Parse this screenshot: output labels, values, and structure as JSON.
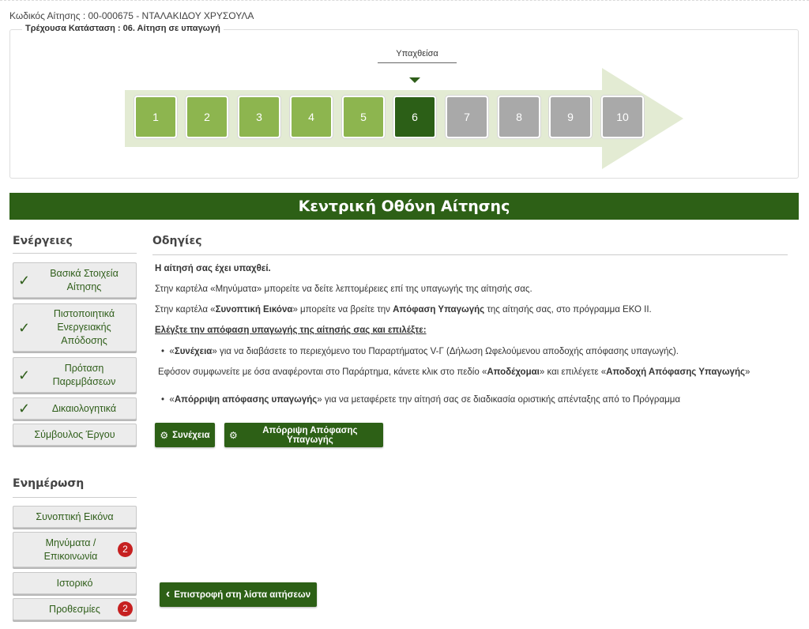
{
  "header": {
    "app_code": "Κωδικός Αίτησης : 00-000675 - ΝΤΑΛΑΚΙΔΟΥ ΧΡΥΣΟΥΛΑ",
    "current_status": "Τρέχουσα Κατάσταση : 06. Αίτηση σε υπαγωγή"
  },
  "progress": {
    "stage_label": "Υπαχθείσα",
    "current_step": 6,
    "steps": [
      {
        "label": "1",
        "state": "done"
      },
      {
        "label": "2",
        "state": "done"
      },
      {
        "label": "3",
        "state": "done"
      },
      {
        "label": "4",
        "state": "done"
      },
      {
        "label": "5",
        "state": "done"
      },
      {
        "label": "6",
        "state": "current"
      },
      {
        "label": "7",
        "state": "todo"
      },
      {
        "label": "8",
        "state": "todo"
      },
      {
        "label": "9",
        "state": "todo"
      },
      {
        "label": "10",
        "state": "todo"
      }
    ]
  },
  "main_title": "Κεντρική Οθόνη Αίτησης",
  "actions": {
    "title": "Ενέργειες",
    "items": [
      {
        "label": "Βασικά Στοιχεία Αίτησης",
        "checked": true
      },
      {
        "label": "Πιστοποιητικά Ενεργειακής Απόδοσης",
        "checked": true
      },
      {
        "label": "Πρόταση Παρεμβάσεων",
        "checked": true
      },
      {
        "label": "Δικαιολογητικά",
        "checked": true
      },
      {
        "label": "Σύμβουλος Έργου",
        "checked": false
      }
    ]
  },
  "info": {
    "title": "Ενημέρωση",
    "items": [
      {
        "label": "Συνοπτική Εικόνα",
        "badge": ""
      },
      {
        "label": "Μηνύματα / Επικοινωνία",
        "badge": "2"
      },
      {
        "label": "Ιστορικό",
        "badge": ""
      },
      {
        "label": "Προθεσμίες",
        "badge": "2"
      }
    ]
  },
  "instructions": {
    "title": "Οδηγίες",
    "heading": "Η αίτησή σας έχει υπαχθεί.",
    "line1": "Στην καρτέλα «Μηνύματα» μπορείτε να δείτε λεπτομέρειες επί της υπαγωγής της αίτησής σας.",
    "line2_a": "Στην καρτέλα «",
    "line2_b": "Συνοπτική Εικόνα",
    "line2_c": "» μπορείτε να βρείτε την ",
    "line2_d": "Απόφαση Υπαγωγής",
    "line2_e": " της αίτησής σας, στο πρόγραμμα ΕΚΟ ΙΙ.",
    "check_line": "Ελέγξτε την απόφαση υπαγωγής της αίτησής σας και επιλέξτε:",
    "bullet1_a": "«",
    "bullet1_b": "Συνέχεια",
    "bullet1_c": "» για να διαβάσετε το περιεχόμενο του Παραρτήματος V-Γ (Δήλωση Ωφελούμενου αποδοχής απόφασης υπαγωγής).",
    "accept_a": "Εφόσον συμφωνείτε με όσα αναφέρονται στο Παράρτημα, κάνετε κλικ στο  πεδίο «",
    "accept_b": "Αποδέχομαι",
    "accept_c": "» και επιλέγετε «",
    "accept_d": "Αποδοχή Απόφασης Υπαγωγής",
    "accept_e": "»",
    "bullet2_a": "«",
    "bullet2_b": "Απόρριψη απόφασης υπαγωγής",
    "bullet2_c": "» για να μεταφέρετε την αίτησή σας σε διαδικασία οριστικής απένταξης  από το Πρόγραμμα"
  },
  "buttons": {
    "continue": "Συνέχεια",
    "reject": "Απόρριψη Απόφασης Υπαγωγής",
    "back": "Επιστροφή στη λίστα αιτήσεων",
    "gear_icon": "⚙",
    "back_icon": "‹"
  },
  "colors": {
    "primary_green": "#2d6016",
    "done_step": "#8db54f",
    "todo_step": "#a9a9a9",
    "badge_red": "#c62020"
  }
}
